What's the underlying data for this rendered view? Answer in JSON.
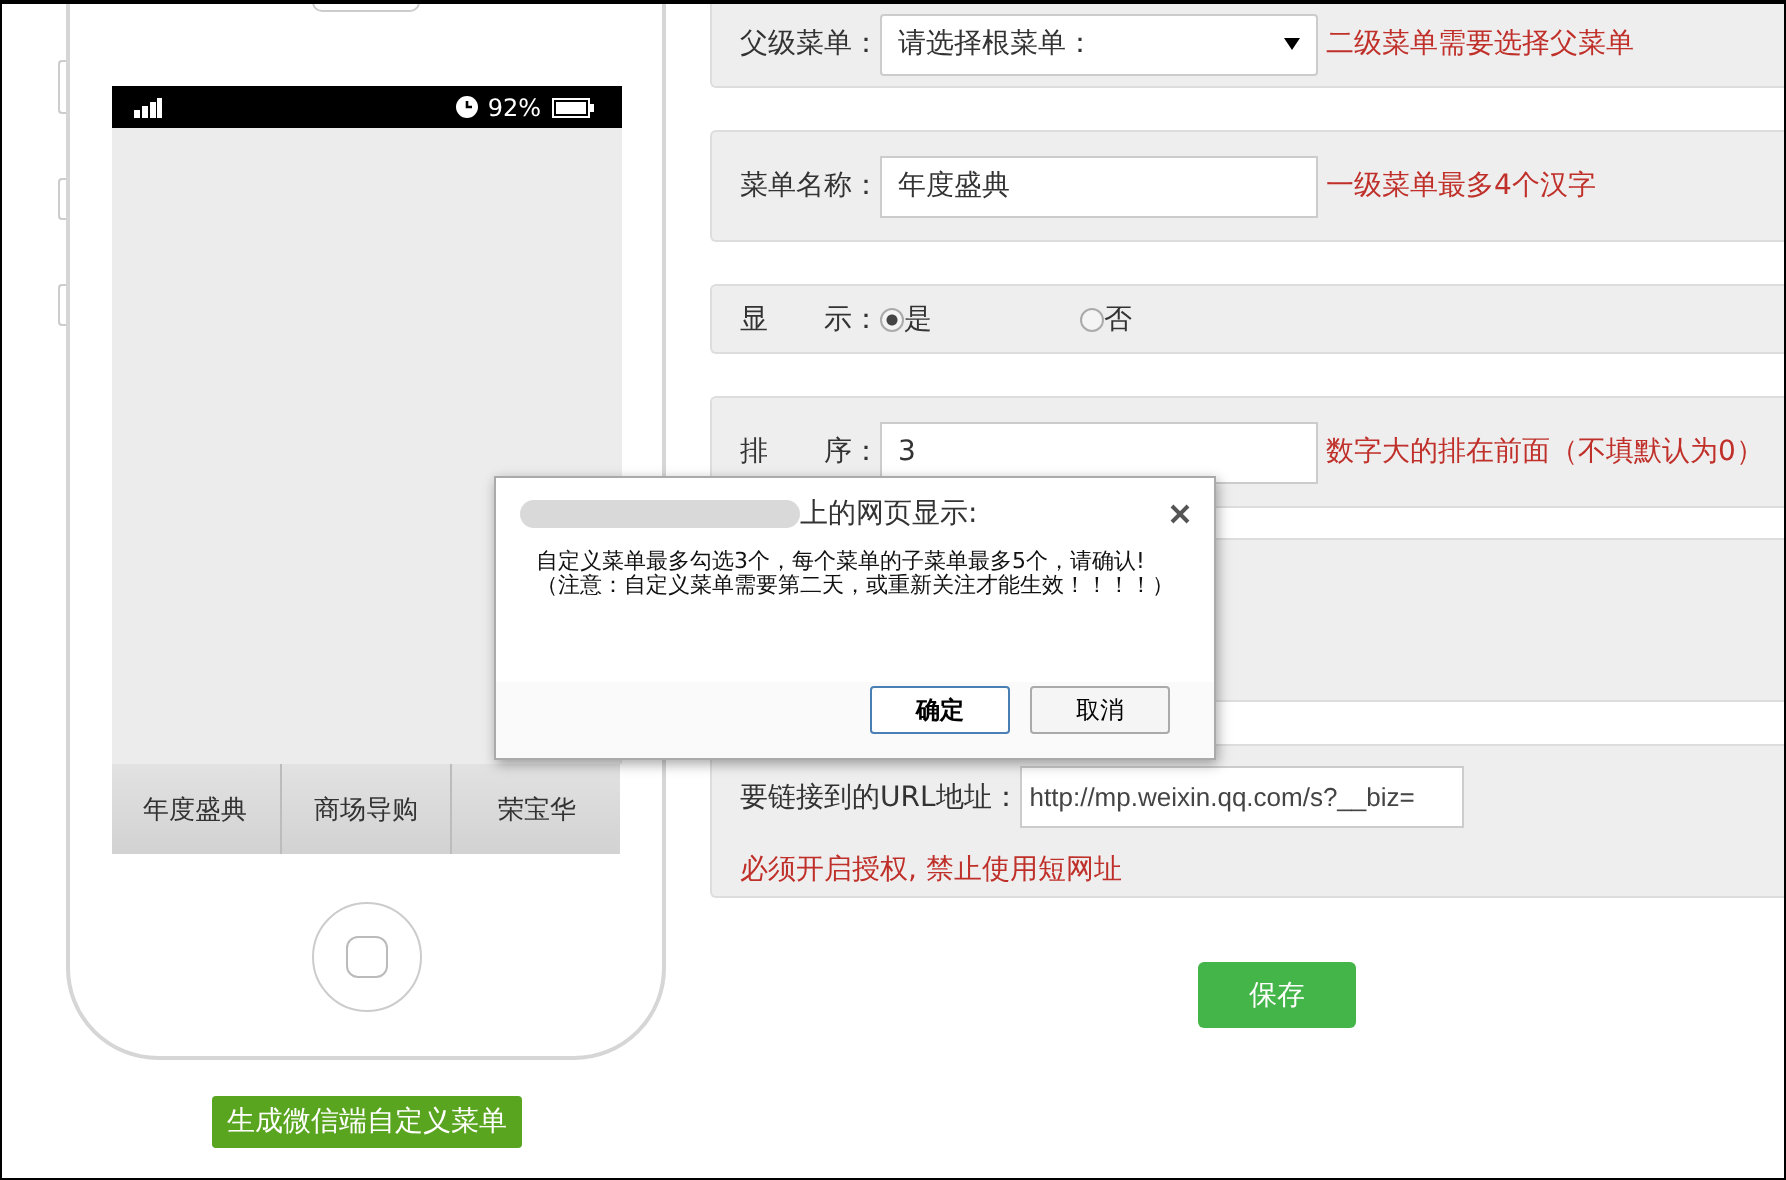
{
  "phone": {
    "status_bar": {
      "battery": "92%"
    },
    "menu": [
      {
        "label": "年度盛典"
      },
      {
        "label": "商场导购"
      },
      {
        "label": "荣宝华"
      }
    ]
  },
  "generate_button": "生成微信端自定义菜单",
  "form": {
    "rows": [
      {
        "kind": "select",
        "label": "父级菜单：",
        "value": "请选择根菜单：",
        "hint": "二级菜单需要选择父菜单"
      },
      {
        "kind": "text",
        "label": "菜单名称：",
        "value": "年度盛典",
        "hint": "一级菜单最多4个汉字"
      },
      {
        "kind": "radio",
        "label": "显　　示：",
        "options": [
          {
            "label": "是",
            "selected": true
          },
          {
            "label": "否",
            "selected": false
          }
        ]
      },
      {
        "kind": "text",
        "label": "排　　序：",
        "value": "3",
        "hint": "数字大的排在前面（不填默认为0）"
      },
      {
        "kind": "blank"
      },
      {
        "kind": "url",
        "label": "要链接到的URL地址：",
        "value": "http://mp.weixin.qq.com/s?__biz=",
        "hint": "必须开启授权, 禁止使用短网址"
      }
    ],
    "save_button": "保存"
  },
  "dialog": {
    "title": "上的网页显示:",
    "message": [
      "自定义菜单最多勾选3个，每个菜单的子菜单最多5个，请确认!",
      "（注意：自定义菜单需要第二天，或重新关注才能生效！！！！）"
    ],
    "buttons": [
      {
        "label": "确定",
        "default": true
      },
      {
        "label": "取消",
        "default": false
      }
    ]
  }
}
